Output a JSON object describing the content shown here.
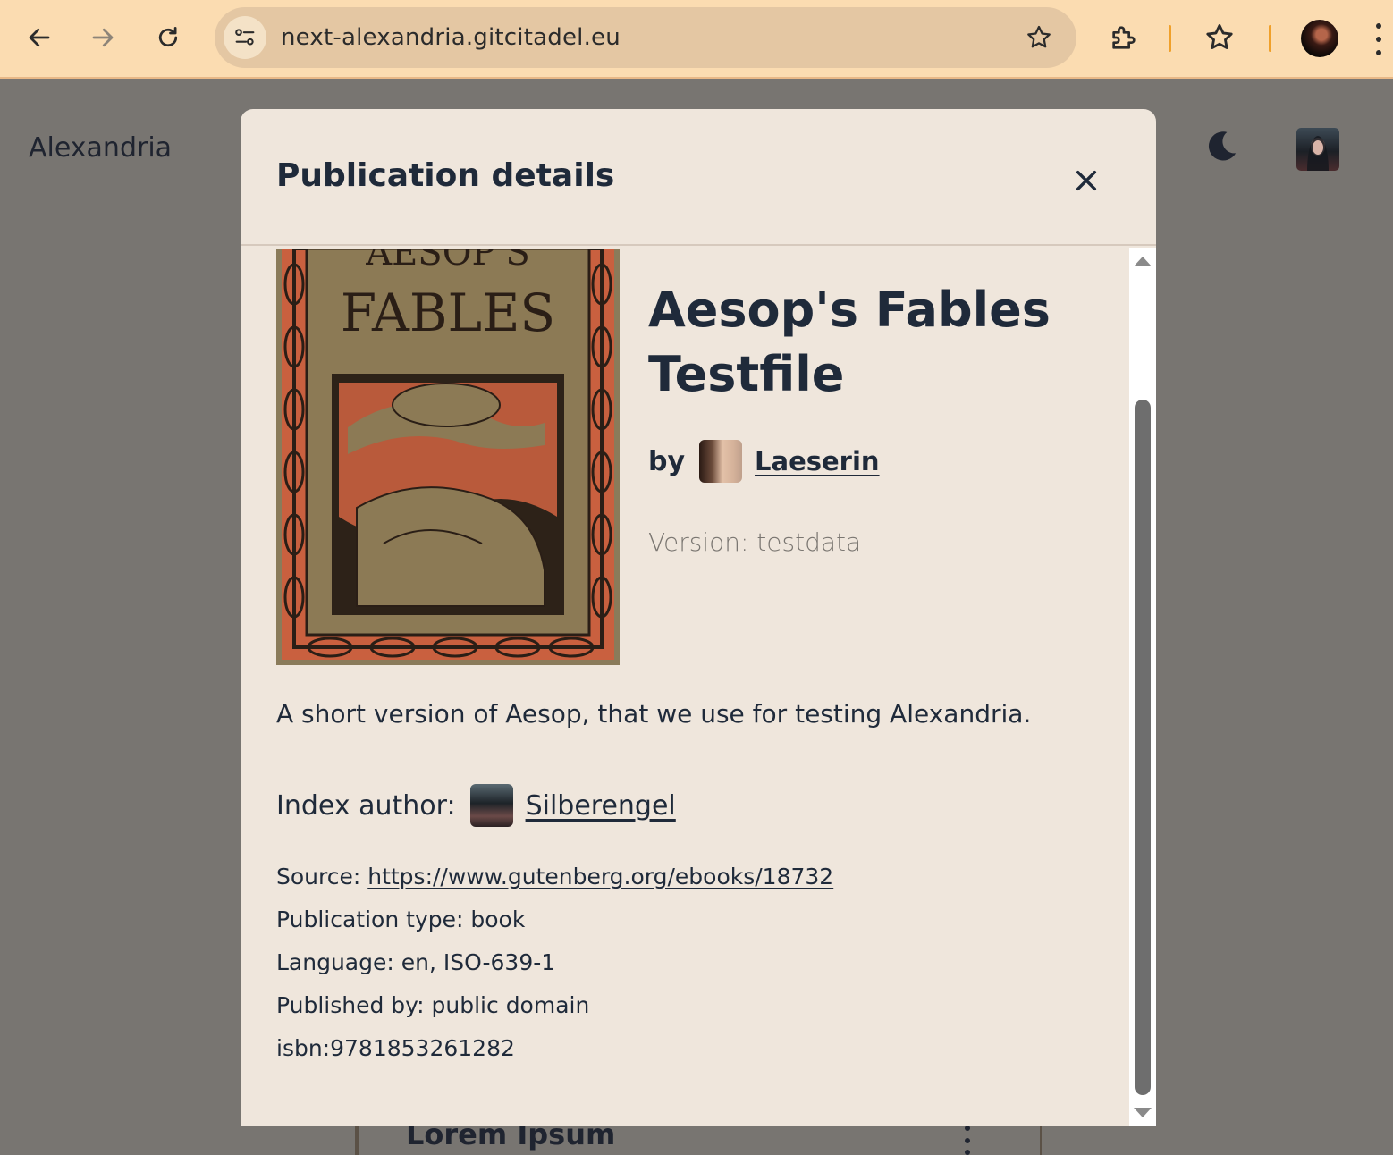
{
  "browser": {
    "url": "next-alexandria.gitcitadel.eu"
  },
  "page": {
    "app_title": "Alexandria",
    "background_card_title": "Lorem Ipsum"
  },
  "modal": {
    "title": "Publication details",
    "close_icon": "close-icon",
    "cover": {
      "title_top": "AESOP'S",
      "title_main": "FABLES"
    },
    "publication_title": "Aesop's Fables Testfile",
    "by_label": "by",
    "author_name": "Laeserin",
    "version_text": "Version: testdata",
    "summary": "A short version of Aesop, that we use for testing Alexandria.",
    "index_author_label": "Index author:",
    "index_author_name": "Silberengel",
    "meta": {
      "source_label": "Source: ",
      "source_url": "https://www.gutenberg.org/ebooks/18732",
      "publication_type": "Publication type: book",
      "language": "Language: en, ISO-639-1",
      "published_by": "Published by: public domain",
      "isbn": "isbn:9781853261282"
    }
  },
  "colors": {
    "chrome_bg": "#fbdcb1",
    "overlay": "#787571",
    "modal_bg": "#efe6dc",
    "text": "#1f2a3a",
    "muted": "#7a7671"
  }
}
